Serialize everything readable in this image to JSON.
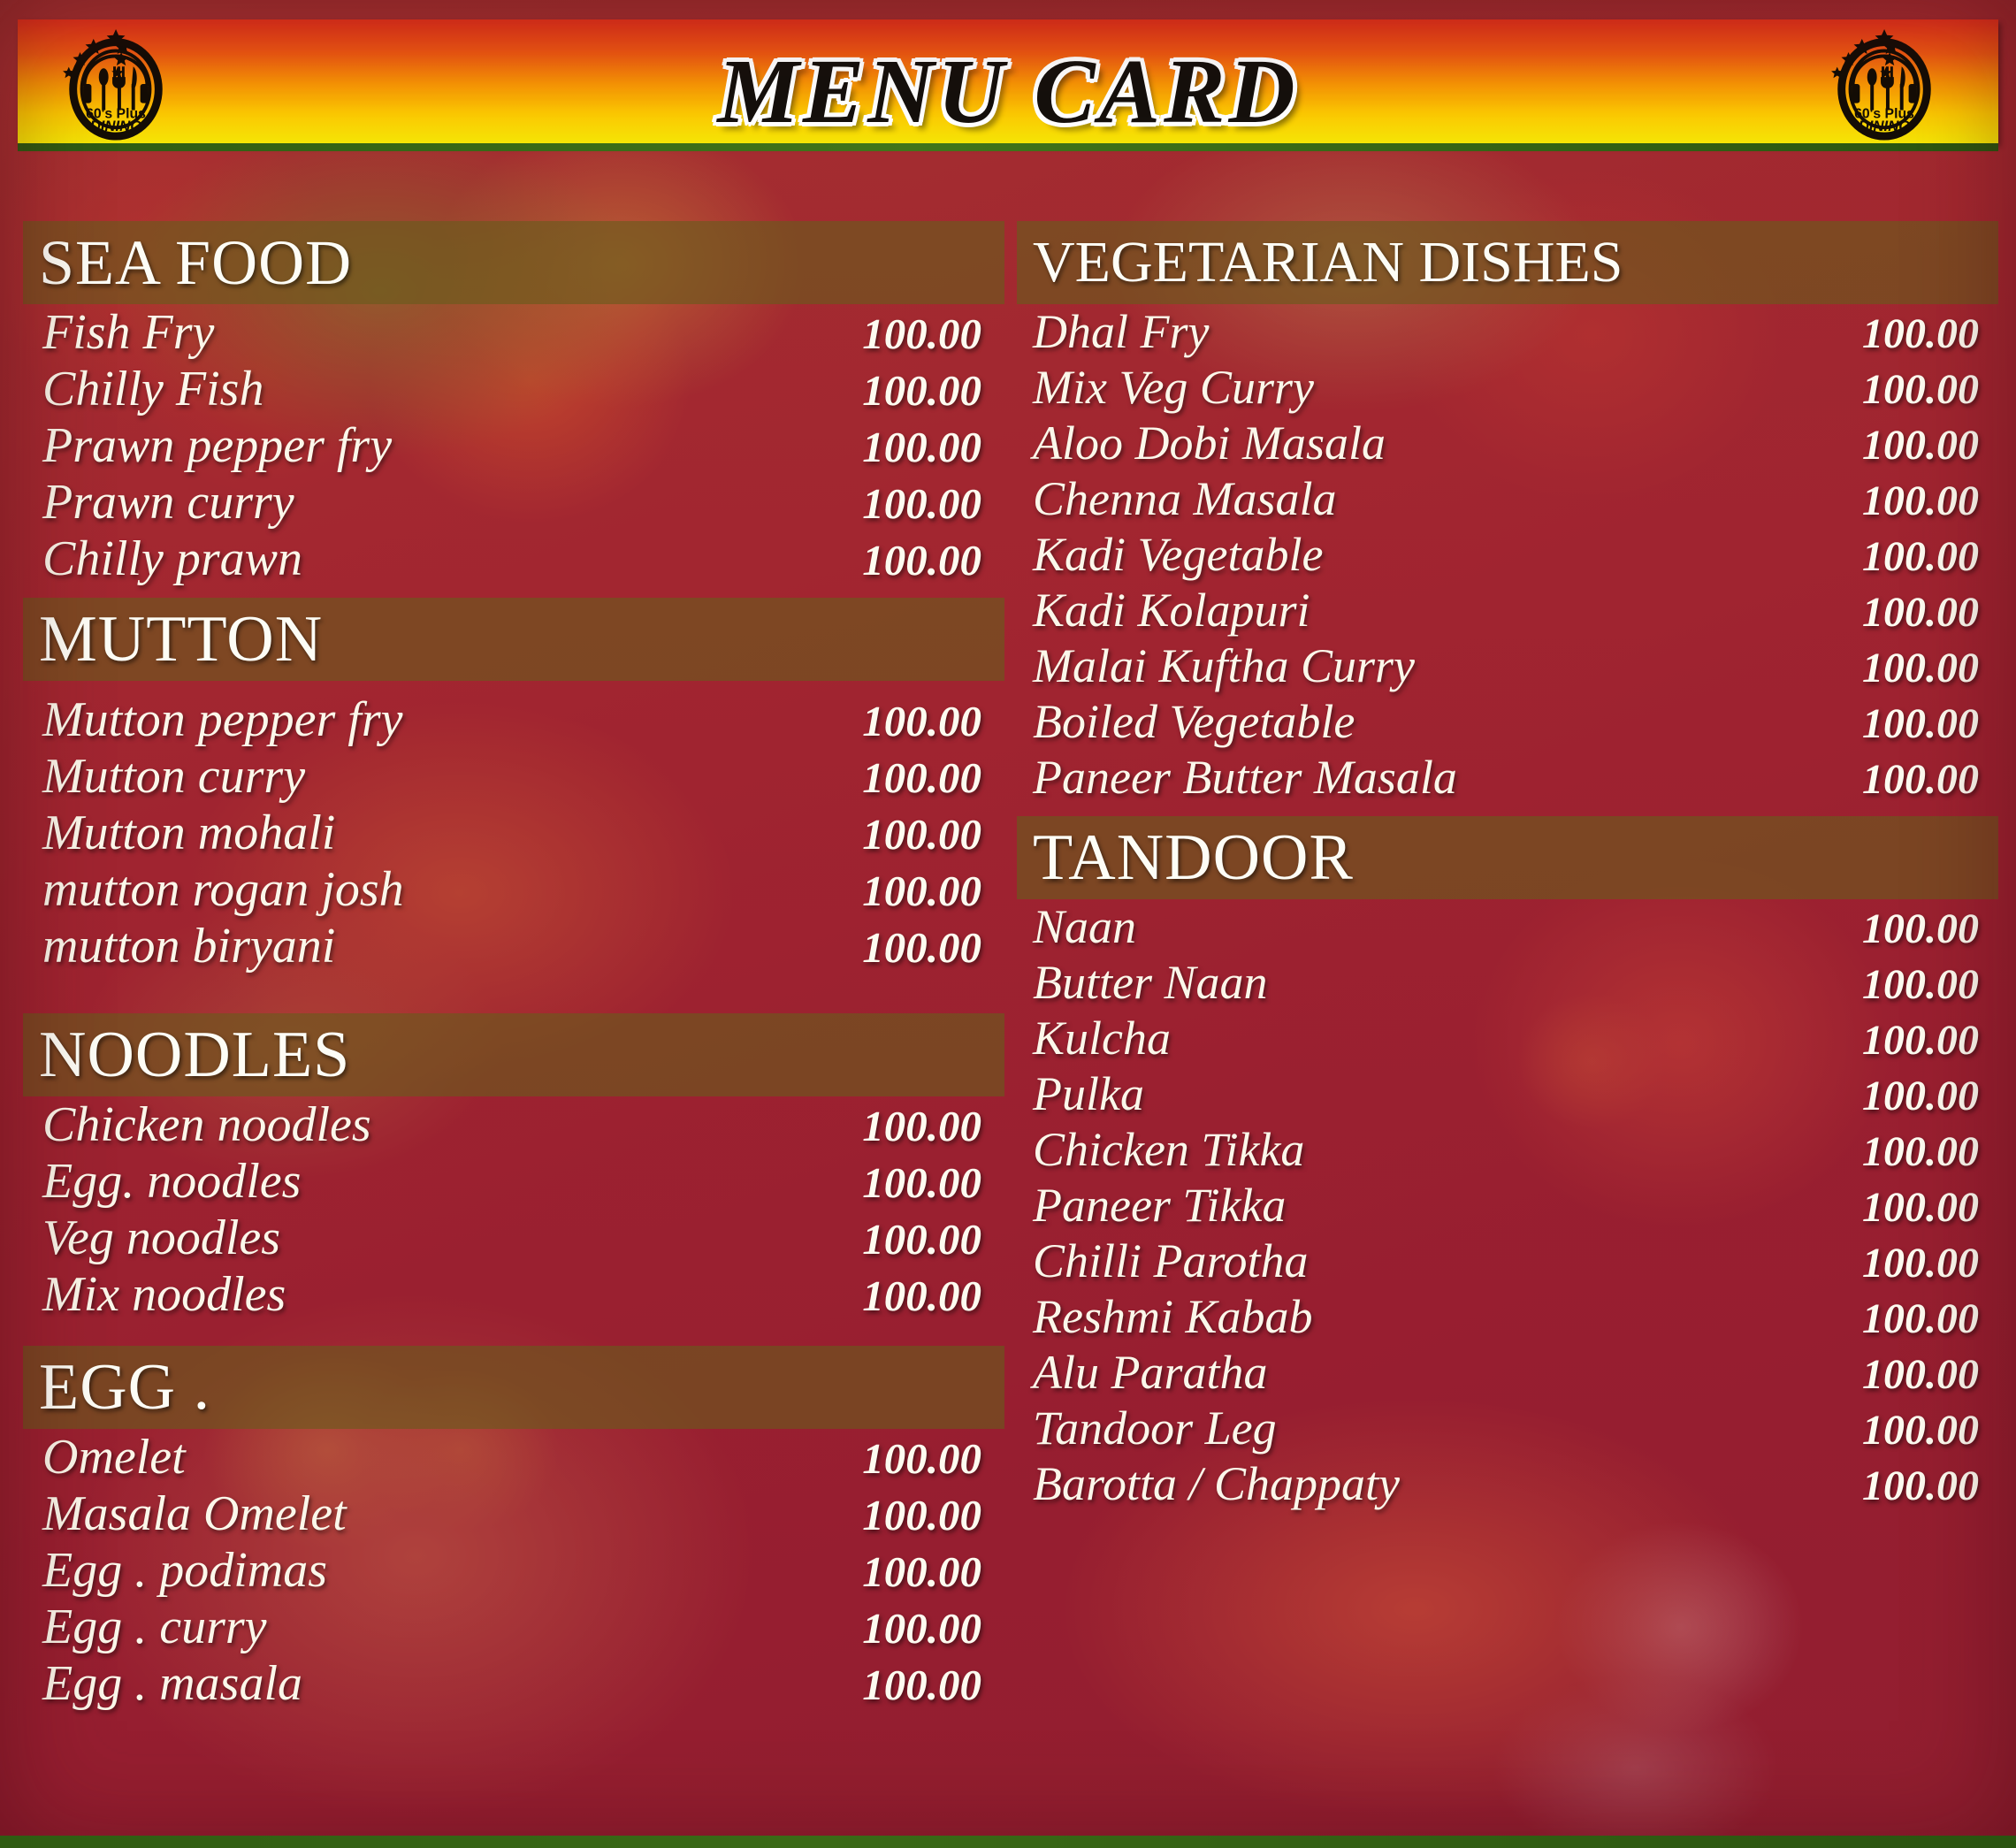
{
  "header": {
    "title": "MENU CARD",
    "logo": {
      "name": "60's Plus DINING",
      "line1": "60's Plus",
      "line2": "DINING"
    },
    "colors": {
      "banner_top": "#e8321c",
      "banner_mid": "#f79405",
      "banner_bottom": "#f5e505",
      "card_red": "#9c2c30",
      "heading_band": "#685c1c"
    }
  },
  "left_column": {
    "sections": [
      {
        "title": "SEA FOOD",
        "items": [
          {
            "name": "Fish Fry",
            "price": "100.00"
          },
          {
            "name": "Chilly Fish",
            "price": "100.00"
          },
          {
            "name": "Prawn pepper fry",
            "price": "100.00"
          },
          {
            "name": "Prawn curry",
            "price": "100.00"
          },
          {
            "name": "Chilly prawn",
            "price": "100.00"
          }
        ]
      },
      {
        "title": "MUTTON",
        "items": [
          {
            "name": "Mutton pepper fry",
            "price": "100.00"
          },
          {
            "name": "Mutton curry",
            "price": "100.00"
          },
          {
            "name": "Mutton mohali",
            "price": "100.00"
          },
          {
            "name": "mutton rogan josh",
            "price": "100.00"
          },
          {
            "name": "mutton biryani",
            "price": "100.00"
          }
        ]
      },
      {
        "title": "NOODLES",
        "items": [
          {
            "name": "Chicken noodles",
            "price": "100.00"
          },
          {
            "name": "Egg. noodles",
            "price": "100.00"
          },
          {
            "name": "Veg noodles",
            "price": "100.00"
          },
          {
            "name": "Mix noodles",
            "price": "100.00"
          }
        ]
      },
      {
        "title": "EGG .",
        "items": [
          {
            "name": "Omelet",
            "price": "100.00"
          },
          {
            "name": "Masala Omelet",
            "price": "100.00"
          },
          {
            "name": "Egg . podimas",
            "price": "100.00"
          },
          {
            "name": "Egg . curry",
            "price": "100.00"
          },
          {
            "name": "Egg . masala",
            "price": "100.00"
          }
        ]
      }
    ]
  },
  "right_column": {
    "sections": [
      {
        "title": "VEGETARIAN DISHES",
        "items": [
          {
            "name": "Dhal Fry",
            "price": "100.00"
          },
          {
            "name": "Mix Veg Curry",
            "price": "100.00"
          },
          {
            "name": "Aloo Dobi Masala",
            "price": "100.00"
          },
          {
            "name": "Chenna Masala",
            "price": "100.00"
          },
          {
            "name": "Kadi Vegetable",
            "price": "100.00"
          },
          {
            "name": "Kadi Kolapuri",
            "price": "100.00"
          },
          {
            "name": "Malai Kuftha Curry",
            "price": "100.00"
          },
          {
            "name": "Boiled Vegetable",
            "price": "100.00"
          },
          {
            "name": "Paneer Butter Masala",
            "price": "100.00"
          }
        ]
      },
      {
        "title": "TANDOOR",
        "items": [
          {
            "name": "Naan",
            "price": "100.00"
          },
          {
            "name": "Butter Naan",
            "price": "100.00"
          },
          {
            "name": "Kulcha",
            "price": "100.00"
          },
          {
            "name": "Pulka",
            "price": "100.00"
          },
          {
            "name": "Chicken Tikka",
            "price": "100.00"
          },
          {
            "name": "Paneer Tikka",
            "price": "100.00"
          },
          {
            "name": "Chilli Parotha",
            "price": "100.00"
          },
          {
            "name": "Reshmi Kabab",
            "price": "100.00"
          },
          {
            "name": "Alu Paratha",
            "price": "100.00"
          },
          {
            "name": "Tandoor Leg",
            "price": "100.00"
          },
          {
            "name": "Barotta / Chappaty",
            "price": "100.00"
          }
        ]
      }
    ]
  }
}
